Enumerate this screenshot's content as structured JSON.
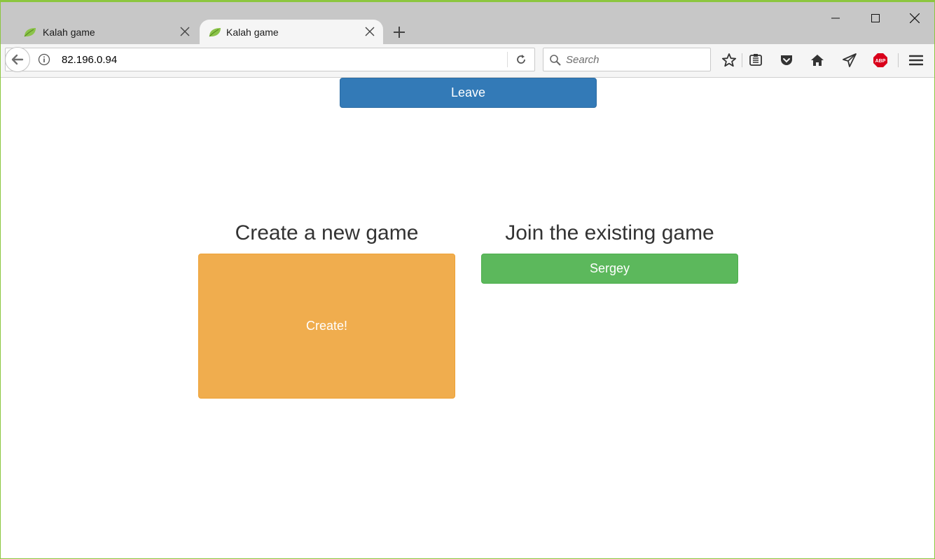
{
  "browser": {
    "tabs": [
      {
        "title": "Kalah game",
        "active": false
      },
      {
        "title": "Kalah game",
        "active": true
      }
    ],
    "url": "82.196.0.94",
    "search_placeholder": "Search",
    "toolbar_icons": [
      "star-icon",
      "reading-list-icon",
      "pocket-icon",
      "home-icon",
      "send-icon",
      "adblock-icon",
      "menu-icon"
    ],
    "adblock_badge": "ABP"
  },
  "page": {
    "leave_label": "Leave",
    "create_heading": "Create a new game",
    "create_label": "Create!",
    "join_heading": "Join the existing game",
    "games": [
      {
        "player": "Sergey"
      }
    ]
  },
  "colors": {
    "primary": "#337ab7",
    "warning": "#f0ad4e",
    "success": "#5cb85c",
    "window_border": "#8cc63f"
  }
}
